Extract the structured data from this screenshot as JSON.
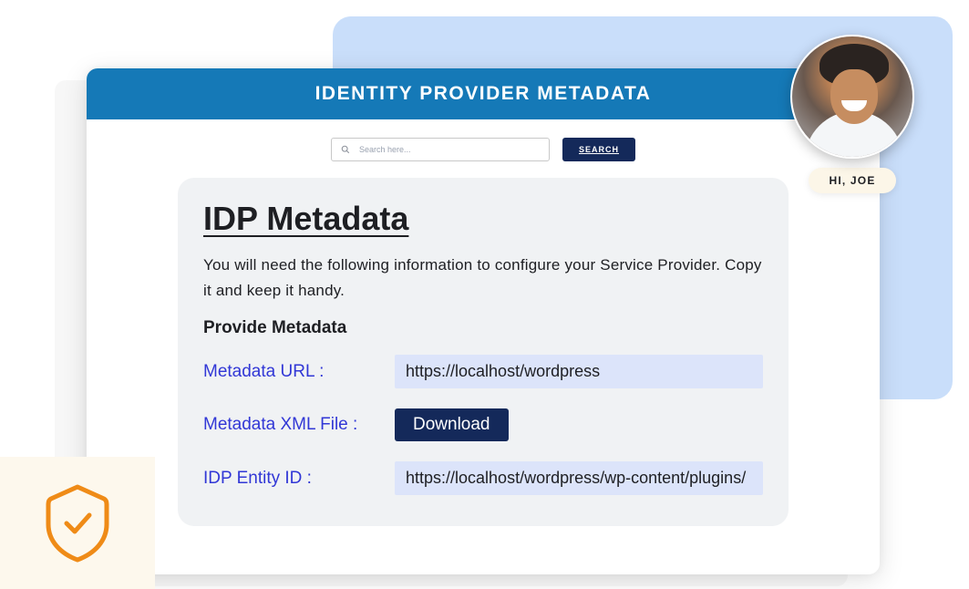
{
  "header": {
    "title": "IDENTITY PROVIDER METADATA"
  },
  "search": {
    "placeholder": "Search here...",
    "button": "SEARCH"
  },
  "user": {
    "greeting": "HI, JOE"
  },
  "card": {
    "title": "IDP Metadata",
    "description": "You will need the following information to configure your Service Provider. Copy it and keep it handy.",
    "subheader": "Provide Metadata",
    "fields": {
      "metadata_url": {
        "label": "Metadata URL :",
        "value": "https://localhost/wordpress"
      },
      "metadata_xml": {
        "label": "Metadata XML File :",
        "button": "Download"
      },
      "entity_id": {
        "label": "IDP Entity ID :",
        "value": "https://localhost/wordpress/wp-content/plugins/"
      }
    }
  }
}
